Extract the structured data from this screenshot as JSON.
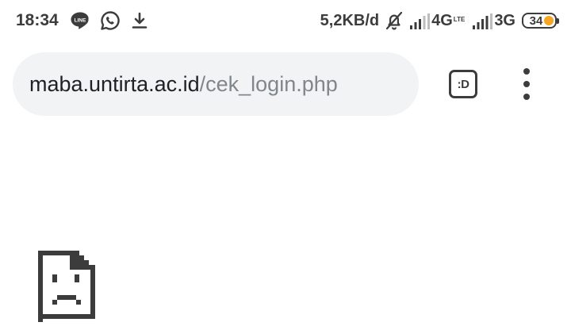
{
  "status_bar": {
    "time": "18:34",
    "notifications": [
      "line-icon",
      "whatsapp-icon",
      "download-icon"
    ],
    "network_speed": "5,2KB/d",
    "sim1_network": "4G",
    "sim1_sub": "LTE",
    "sim2_network": "3G",
    "battery_percent": "34",
    "battery_level": 0.34,
    "battery_color": "#f5a623"
  },
  "toolbar": {
    "url_host": "maba.untirta.ac.id",
    "url_path": "/cek_login.php",
    "tab_count_label": ":D"
  },
  "page": {
    "icon": "sad-page-error-icon"
  },
  "colors": {
    "omnibox_bg": "#f1f3f4",
    "url_host": "#202124",
    "url_path": "#80868b",
    "icon": "#3c3c3c"
  }
}
